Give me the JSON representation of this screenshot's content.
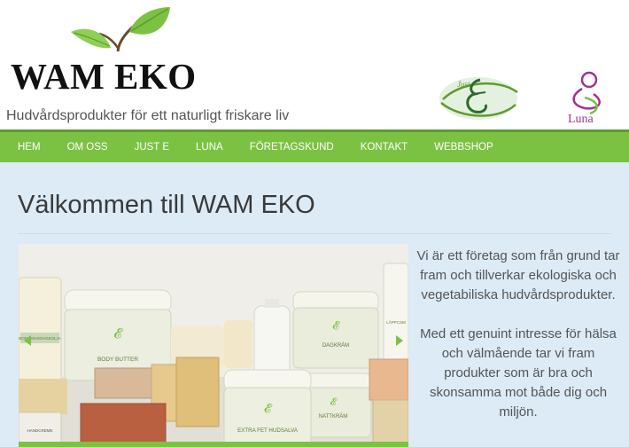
{
  "header": {
    "logo_text": "WAM EKO",
    "tagline": "Hudvårdsprodukter för ett naturligt friskare liv",
    "brands": [
      {
        "script": "Just",
        "icon": "just-e-logo-icon"
      },
      {
        "label": "Luna",
        "icon": "luna-logo-icon"
      }
    ]
  },
  "nav": {
    "items": [
      "HEM",
      "OM OSS",
      "JUST E",
      "LUNA",
      "FÖRETAGSKUND",
      "KONTAKT",
      "WEBBSHOP"
    ]
  },
  "main": {
    "title": "Välkommen till WAM EKO",
    "slider": {
      "labels": [
        "BODY BUTTER",
        "DAGKRÄM",
        "NATTKRÄM",
        "EXTRA FET HUDSALVA",
        "LÄPPCSM",
        "BODY MASSAGEOLJA",
        "HANDCREME"
      ]
    },
    "intro_paragraphs": [
      "Vi är ett företag som från grund tar fram och tillverkar ekologiska och vegetabiliska hudvårdsprodukter.",
      "Med ett genuint intresse för hälsa och välmående tar vi fram produkter som är bra och skonsamma mot både dig och miljön."
    ]
  },
  "colors": {
    "nav_green": "#7cc242",
    "leaf_green": "#7cc242",
    "background": "#dcebf6",
    "luna_purple": "#a3338a"
  }
}
